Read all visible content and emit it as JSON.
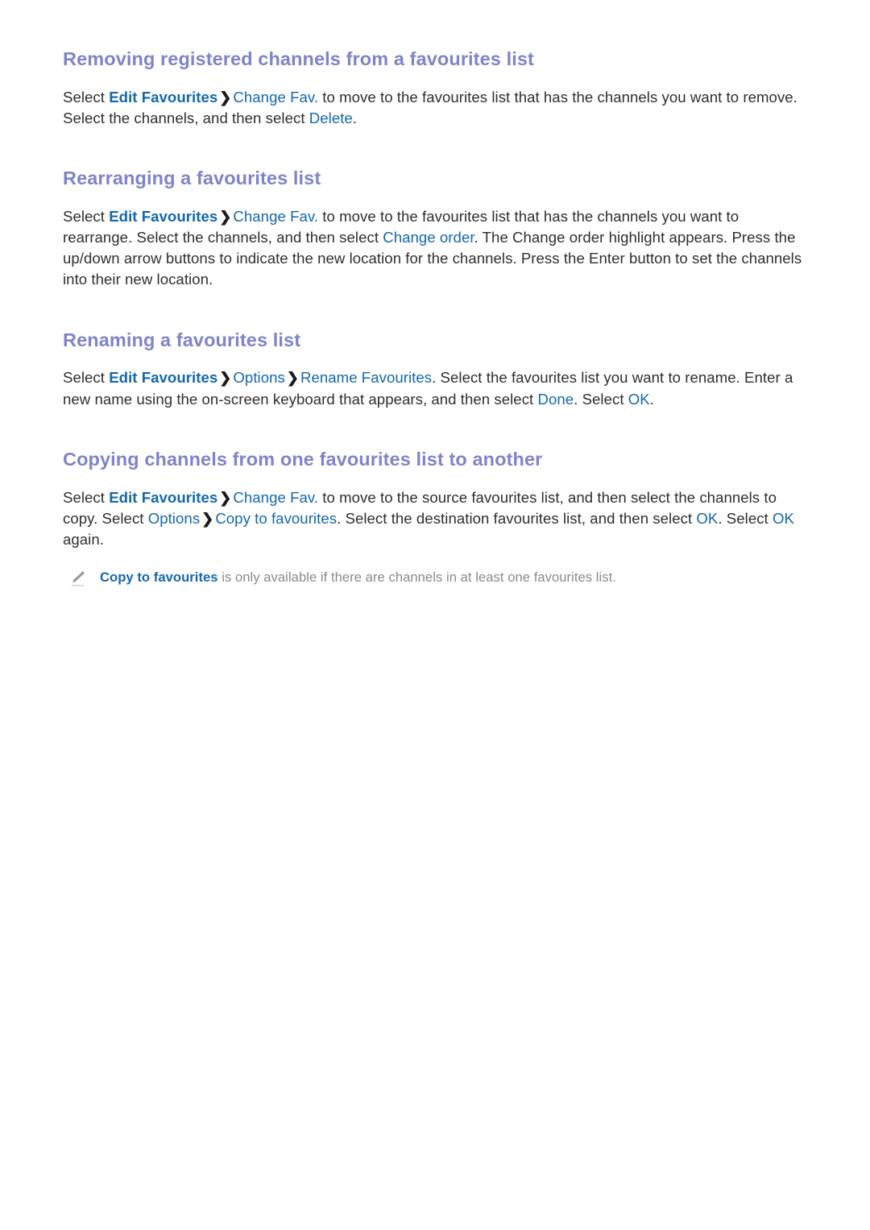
{
  "page": {
    "background_color": "#ffffff",
    "heading_color": "#7f84c8",
    "link_color": "#1368ad",
    "body_color": "#2f2f2f",
    "note_color": "#8a8a8a"
  },
  "sections": [
    {
      "id": "removing-registered-channels",
      "heading": "Removing registered channels from a favourites list",
      "paragraph": {
        "p1": "Select ",
        "link1": "Edit Favourites",
        "chevron1": "❯",
        "link2": "Change Fav.",
        "p2": " to move to the favourites list that has the channels you want to remove. Select the channels, and then select ",
        "link3": "Delete",
        "p3": "."
      }
    },
    {
      "id": "rearranging-favourites-list",
      "heading": "Rearranging a favourites list",
      "paragraph": {
        "p1": "Select ",
        "link1": "Edit Favourites",
        "chevron1": "❯",
        "link2": "Change Fav.",
        "p2": " to move to the favourites list that has the channels you want to rearrange. Select the channels, and then select ",
        "link3": "Change order",
        "p3": ". The Change order highlight appears. Press the up/down arrow buttons to indicate the new location for the channels. Press the Enter button to set the channels into their new location."
      }
    },
    {
      "id": "renaming-favourites-list",
      "heading": "Renaming a favourites list",
      "paragraph": {
        "p1": "Select ",
        "link1": "Edit Favourites",
        "chevron1": "❯",
        "link2": "Options",
        "chevron2": "❯",
        "link3": "Rename Favourites",
        "p2": ". Select the favourites list you want to rename. Enter a new name using the on-screen keyboard that appears, and then select ",
        "link4": "Done",
        "p3": ". Select ",
        "link5": "OK",
        "p4": "."
      }
    },
    {
      "id": "copying-channels",
      "heading": "Copying channels from one favourites list to another",
      "paragraph": {
        "p1": "Select ",
        "link1": "Edit Favourites",
        "chevron1": "❯",
        "link2": "Change Fav.",
        "p2": " to move to the source favourites list, and then select the channels to copy. Select ",
        "link3": "Options",
        "chevron2": "❯",
        "link4": "Copy to favourites",
        "p3": ". Select the destination favourites list, and then select ",
        "link5": "OK",
        "p4": ". Select ",
        "link6": "OK",
        "p5": " again."
      },
      "note": {
        "icon": "pencil-icon",
        "link": "Copy to favourites",
        "text": " is only available if there are channels in at least one favourites list."
      }
    }
  ]
}
